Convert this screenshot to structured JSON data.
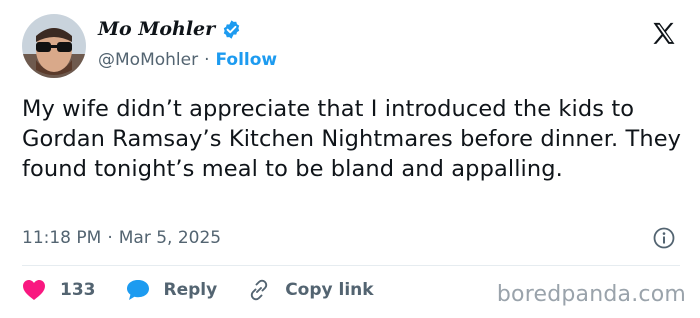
{
  "author": {
    "display_name": "Mo Mohler",
    "handle": "@MoMohler",
    "separator": "·",
    "follow_label": "Follow"
  },
  "tweet": {
    "text": "My wife didn’t appreciate that I introduced the kids to Gordan Ramsay’s Kitchen Nightmares before dinner. They found tonight’s meal to be bland and appalling.",
    "time": "11:18 PM",
    "separator": "·",
    "date": "Mar 5, 2025"
  },
  "actions": {
    "like_count": "133",
    "reply_label": "Reply",
    "copy_link_label": "Copy link"
  },
  "watermark": "boredpanda.com",
  "colors": {
    "accent": "#1d9bf0",
    "like": "#f91880",
    "text": "#0f1419",
    "muted": "#536471"
  },
  "icons": [
    "verified-badge-icon",
    "x-logo-icon",
    "info-icon",
    "heart-icon",
    "reply-bubble-icon",
    "link-icon"
  ]
}
